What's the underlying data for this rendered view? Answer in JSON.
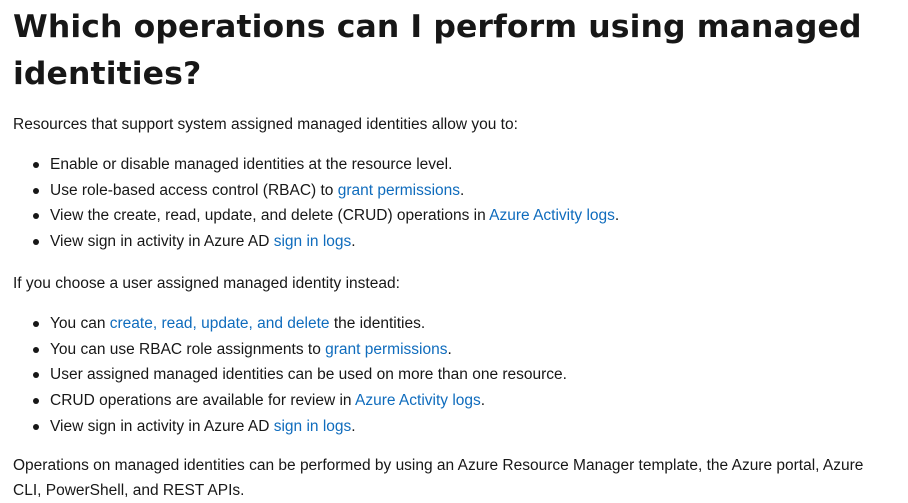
{
  "heading": "Which operations can I perform using managed identities?",
  "intro_system": "Resources that support system assigned managed identities allow you to:",
  "system_items": [
    {
      "before": "Enable or disable managed identities at the resource level.",
      "link": "",
      "after": ""
    },
    {
      "before": "Use role-based access control (RBAC) to ",
      "link": "grant permissions",
      "after": "."
    },
    {
      "before": "View the create, read, update, and delete (CRUD) operations in ",
      "link": "Azure Activity logs",
      "after": "."
    },
    {
      "before": "View sign in activity in Azure AD ",
      "link": "sign in logs",
      "after": "."
    }
  ],
  "intro_user": "If you choose a user assigned managed identity instead:",
  "user_items": [
    {
      "before": "You can ",
      "link": "create, read, update, and delete",
      "after": " the identities."
    },
    {
      "before": "You can use RBAC role assignments to ",
      "link": "grant permissions",
      "after": "."
    },
    {
      "before": "User assigned managed identities can be used on more than one resource.",
      "link": "",
      "after": ""
    },
    {
      "before": "CRUD operations are available for review in ",
      "link": "Azure Activity logs",
      "after": "."
    },
    {
      "before": "View sign in activity in Azure AD ",
      "link": "sign in logs",
      "after": "."
    }
  ],
  "closing": "Operations on managed identities can be performed by using an Azure Resource Manager template, the Azure portal, Azure CLI, PowerShell, and REST APIs.",
  "colors": {
    "text": "#171717",
    "link": "#0f6cbd",
    "background": "#ffffff"
  }
}
